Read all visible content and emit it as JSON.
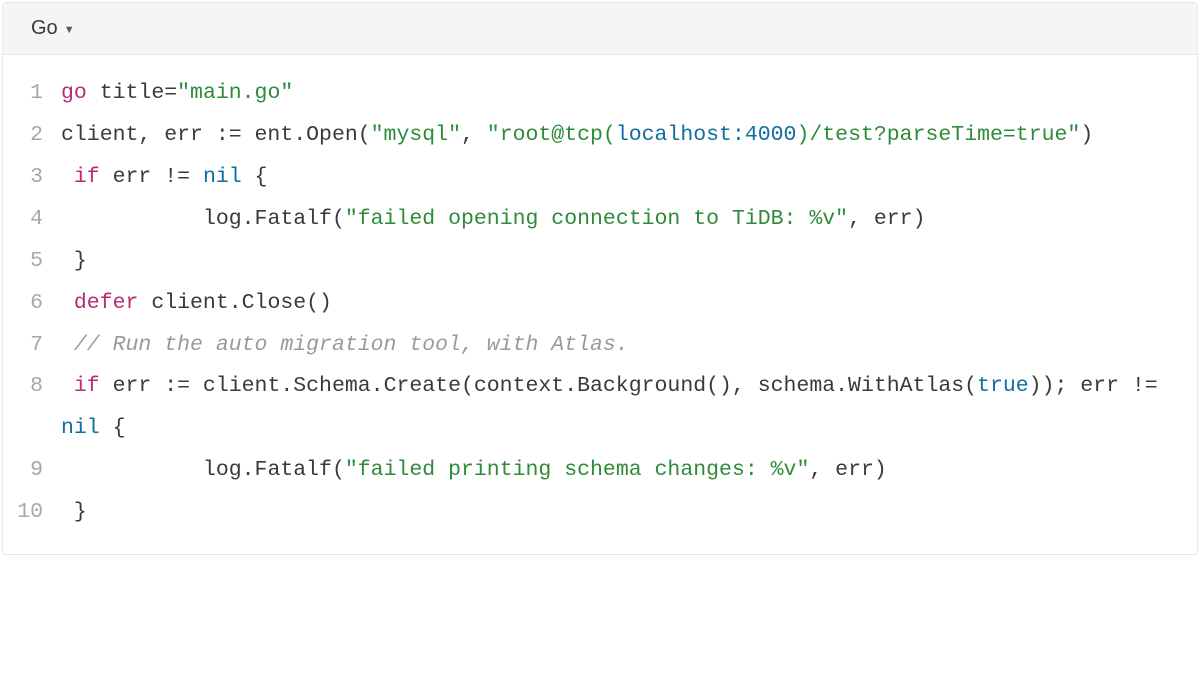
{
  "header": {
    "language": "Go"
  },
  "code": {
    "lines": [
      {
        "n": "1"
      },
      {
        "n": "2"
      },
      {
        "n": "3"
      },
      {
        "n": "4"
      },
      {
        "n": "5"
      },
      {
        "n": "6"
      },
      {
        "n": "7"
      },
      {
        "n": "8"
      },
      {
        "n": "9"
      },
      {
        "n": "10"
      }
    ],
    "tokens": {
      "l1": {
        "kw_go": "go",
        "t1": " title=",
        "s1": "\"main.go\""
      },
      "l2": {
        "t1": "client, err := ent.Open(",
        "s1": "\"mysql\"",
        "t2": ", ",
        "s2a": "\"root@tcp(",
        "num_host": "localhost:4000",
        "s2b": ")/test?parseTime=true\"",
        "t3": ")"
      },
      "l3": {
        "sp": " ",
        "kw_if": "if",
        "t1": " err != ",
        "kw_nil": "nil",
        "t2": " {"
      },
      "l4": {
        "sp": "           log.Fatalf(",
        "s1": "\"failed opening connection to TiDB: %v\"",
        "t1": ", err)"
      },
      "l5": {
        "t1": " }"
      },
      "l6": {
        "sp": " ",
        "kw_defer": "defer",
        "t1": " client.Close()"
      },
      "l7": {
        "sp": " ",
        "com": "// Run the auto migration tool, with Atlas."
      },
      "l8": {
        "sp": " ",
        "kw_if": "if",
        "t1": " err := client.Schema.Create(context.Background(), schema.WithAtlas(",
        "kw_true": "true",
        "t2": ")); err != ",
        "kw_nil": "nil",
        "t3": " {"
      },
      "l9": {
        "sp": "           log.Fatalf(",
        "s1": "\"failed printing schema changes: %v\"",
        "t1": ", err)"
      },
      "l10": {
        "t1": " }"
      }
    }
  }
}
